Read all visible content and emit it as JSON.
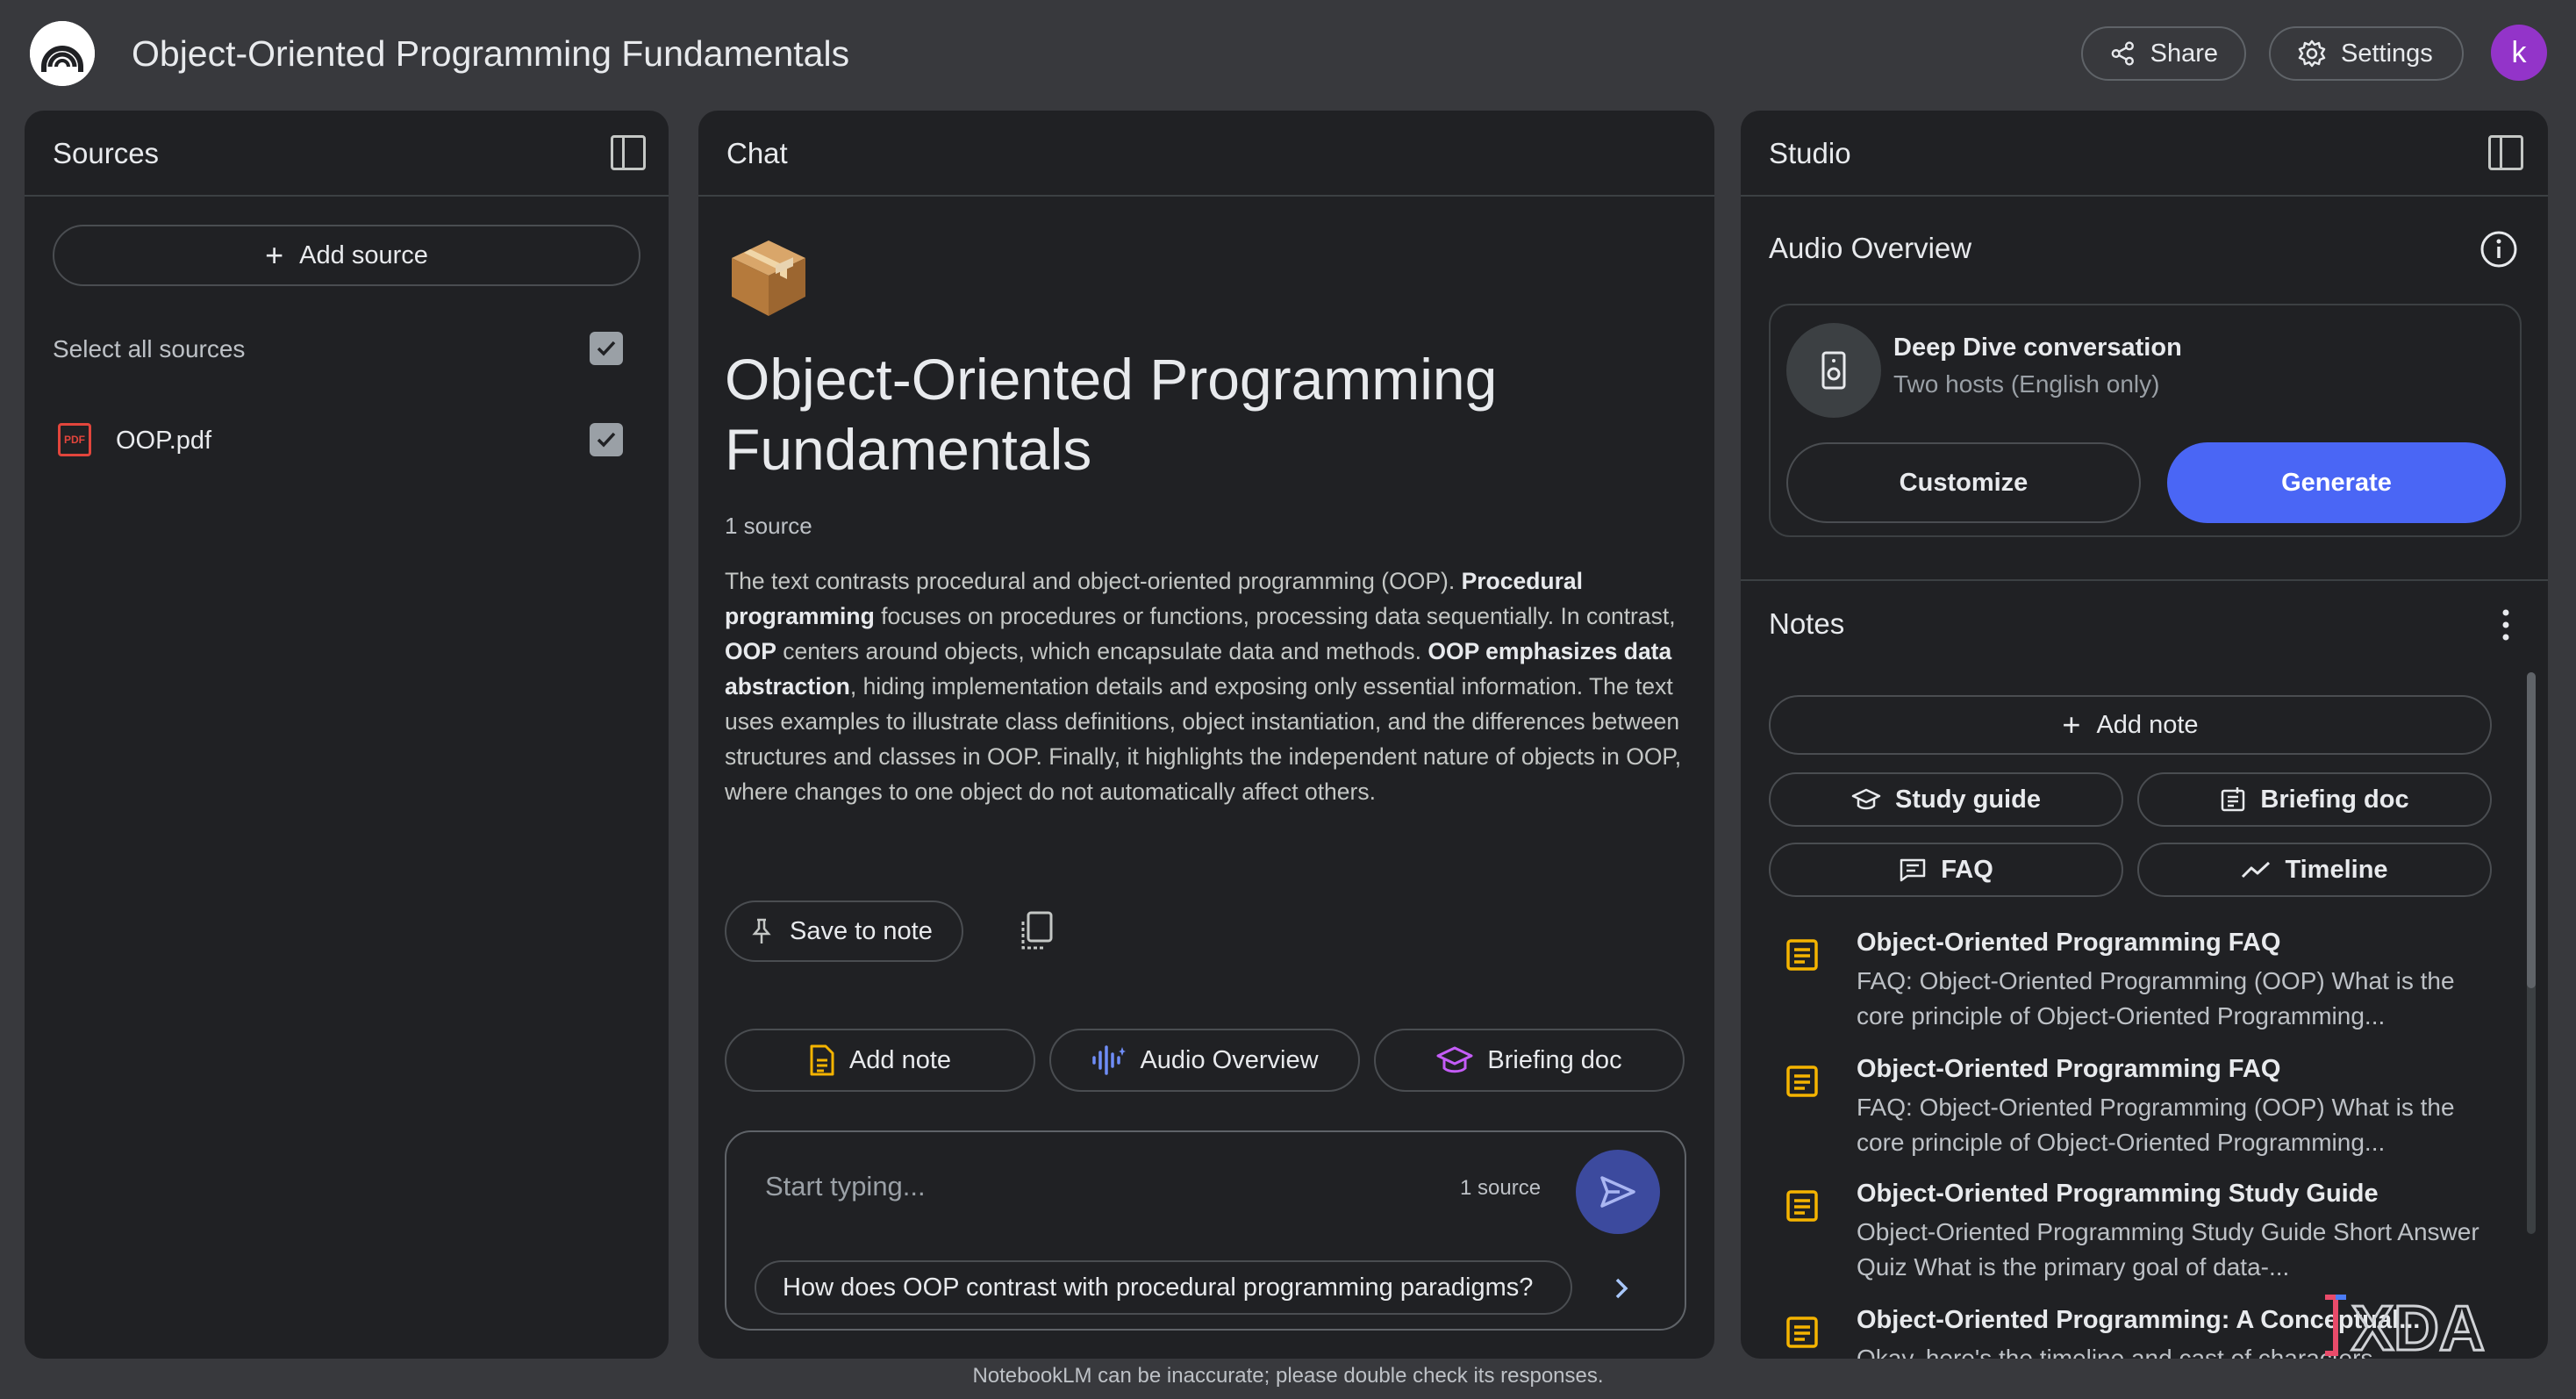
{
  "header": {
    "title": "Object-Oriented Programming Fundamentals",
    "share_label": "Share",
    "settings_label": "Settings",
    "avatar_letter": "k",
    "avatar_color": "#9334c9"
  },
  "sources": {
    "panel_title": "Sources",
    "add_source_label": "Add source",
    "select_all_label": "Select all sources",
    "select_all_checked": true,
    "items": [
      {
        "name": "OOP.pdf",
        "type": "pdf-icon",
        "checked": true
      }
    ]
  },
  "chat": {
    "panel_title": "Chat",
    "emoji": "package-icon",
    "notebook_title": "Object-Oriented Programming Fundamentals",
    "source_count": "1 source",
    "summary": [
      {
        "text": "The text contrasts procedural and object-oriented programming (OOP). ",
        "bold": false
      },
      {
        "text": "Procedural programming",
        "bold": true
      },
      {
        "text": " focuses on procedures or functions, processing data sequentially. In contrast, ",
        "bold": false
      },
      {
        "text": "OOP",
        "bold": true
      },
      {
        "text": " centers around objects, which encapsulate data and methods. ",
        "bold": false
      },
      {
        "text": "OOP emphasizes data abstraction",
        "bold": true
      },
      {
        "text": ", hiding implementation details and exposing only essential information. The text uses examples to illustrate class definitions, object instantiation, and the differences between structures and classes in OOP. Finally, it highlights the independent nature of objects in OOP, where changes to one object do not automatically affect others.",
        "bold": false
      }
    ],
    "save_to_note_label": "Save to note",
    "actions": {
      "add_note_label": "Add note",
      "audio_overview_label": "Audio Overview",
      "briefing_doc_label": "Briefing doc"
    },
    "composer": {
      "placeholder": "Start typing...",
      "source_count": "1 source",
      "suggestion": "How does OOP contrast with procedural programming paradigms?"
    }
  },
  "studio": {
    "panel_title": "Studio",
    "audio_overview": {
      "title": "Audio Overview",
      "card_title": "Deep Dive conversation",
      "card_subtitle": "Two hosts (English only)",
      "customize_label": "Customize",
      "generate_label": "Generate"
    },
    "notes": {
      "title": "Notes",
      "add_note_label": "Add note",
      "types": {
        "study_guide": "Study guide",
        "briefing_doc": "Briefing doc",
        "faq": "FAQ",
        "timeline": "Timeline"
      },
      "items": [
        {
          "title": "Object-Oriented Programming FAQ",
          "snippet": "FAQ: Object-Oriented Programming (OOP) What is the core principle of Object-Oriented Programming..."
        },
        {
          "title": "Object-Oriented Programming FAQ",
          "snippet": "FAQ: Object-Oriented Programming (OOP) What is the core principle of Object-Oriented Programming..."
        },
        {
          "title": "Object-Oriented Programming Study Guide",
          "snippet": "Object-Oriented Programming Study Guide Short Answer Quiz What is the primary goal of data-..."
        },
        {
          "title": "Object-Oriented Programming: A Conceptual...",
          "snippet": "Okay, here's the timeline and cast of characters..."
        }
      ]
    }
  },
  "footer": {
    "disclaimer": "NotebookLM can be inaccurate; please double check its responses."
  },
  "watermark": {
    "text": "XDA"
  },
  "colors": {
    "background": "#38393d",
    "panel": "#202124",
    "accent_blue": "#4a66f5",
    "note_icon_yellow": "#f5b400",
    "briefing_purple": "#a142f4"
  }
}
